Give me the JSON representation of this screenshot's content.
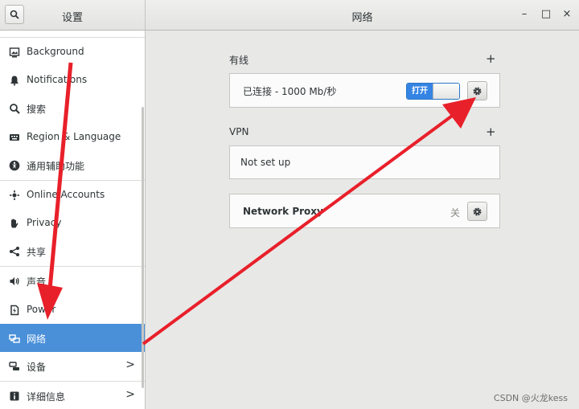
{
  "app": {
    "title": "设置"
  },
  "header": {
    "page_title": "网络",
    "minimize": "–",
    "maximize": "□",
    "close": "×"
  },
  "sidebar": {
    "items": [
      {
        "label": "Background",
        "icon": "background-icon"
      },
      {
        "label": "Notifications",
        "icon": "bell-icon"
      },
      {
        "label": "搜索",
        "icon": "search-icon"
      },
      {
        "label": "Region & Language",
        "icon": "keyboard-icon"
      },
      {
        "label": "通用辅助功能",
        "icon": "accessibility-icon"
      },
      {
        "label": "Online Accounts",
        "icon": "online-accounts-icon"
      },
      {
        "label": "Privacy",
        "icon": "hand-icon"
      },
      {
        "label": "共享",
        "icon": "share-icon"
      },
      {
        "label": "声音",
        "icon": "speaker-icon"
      },
      {
        "label": "Power",
        "icon": "power-icon"
      },
      {
        "label": "网络",
        "icon": "network-icon",
        "selected": true
      },
      {
        "label": "设备",
        "icon": "devices-icon",
        "chevron": ">"
      },
      {
        "label": "详细信息",
        "icon": "info-icon",
        "chevron": ">"
      }
    ]
  },
  "wired": {
    "title": "有线",
    "add": "+",
    "status": "已连接 - 1000 Mb/秒",
    "toggle_label": "打开",
    "toggle_on": true
  },
  "vpn": {
    "title": "VPN",
    "add": "+",
    "status": "Not set up"
  },
  "proxy": {
    "label": "Network Proxy",
    "state": "关"
  },
  "watermark": "CSDN @火龙kess",
  "colors": {
    "selection": "#4a90d9",
    "toggle_on": "#3584e4",
    "annotation_arrow": "#e8202a"
  }
}
